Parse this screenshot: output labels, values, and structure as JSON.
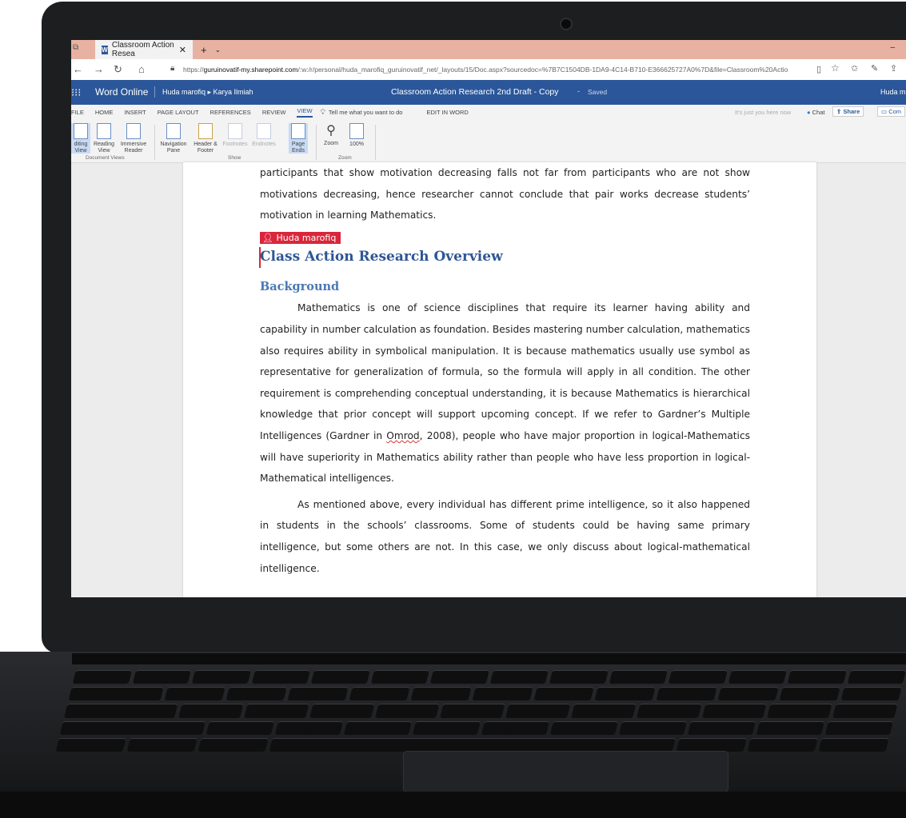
{
  "browser": {
    "tab_title": "Classroom Action Resea",
    "url_host": "guruinovatif-my.sharepoint.com",
    "url_rest": "/:w:/r/personal/huda_marofiq_guruinovatif_net/_layouts/15/Doc.aspx?sourcedoc=%7B7C1504DB-1DA9-4C14-B710-E366625727A0%7D&file=Classroom%20Actio",
    "url_scheme": "https://",
    "accent": "#e8b2a2"
  },
  "app": {
    "name": "Word Online",
    "breadcrumb": "Huda marofiq ▸ Karya Ilmiah",
    "doc_title": "Classroom Action Research 2nd Draft - Copy",
    "save_state": "Saved",
    "user": "Huda m",
    "brand_color": "#2b579a"
  },
  "ribbon_tabs": [
    "FILE",
    "HOME",
    "INSERT",
    "PAGE LAYOUT",
    "REFERENCES",
    "REVIEW",
    "VIEW"
  ],
  "ribbon_extra": {
    "tell_me": "Tell me what you want to do",
    "edit_in_word": "EDIT IN WORD",
    "presence": "It's just you here now",
    "chat": "Chat",
    "share": "Share",
    "comments": "Com"
  },
  "ribbon": {
    "editing_view": [
      "diting",
      "View"
    ],
    "reading_view": [
      "Reading",
      "View"
    ],
    "immersive_reader": [
      "Immersive",
      "Reader"
    ],
    "document_views": "Document Views",
    "navigation_pane": [
      "Navigation",
      "Pane"
    ],
    "header_footer": [
      "Header &",
      "Footer"
    ],
    "footnotes": "Footnotes",
    "endnotes": "Endnotes",
    "page_ends": [
      "Page",
      "Ends"
    ],
    "show": "Show",
    "zoom": "Zoom",
    "zoom_100": "100%",
    "zoom_group": "Zoom"
  },
  "document": {
    "para_top": "participants that show motivation decreasing falls not far from participants who are not show motivations decreasing, hence researcher cannot conclude that pair works decrease students’ motivation in learning Mathematics.",
    "author_flag": "Huda marofiq",
    "heading1": "Class Action Research Overview",
    "heading2": "Background",
    "para1_a": "Mathematics is one of science disciplines that require its learner having ability and capability in number calculation as foundation. Besides mastering number calculation, mathematics also requires ability in symbolical manipulation. It is because mathematics usually use symbol as representative for generalization of formula, so the formula will apply in all condition. The other requirement is comprehending conceptual understanding, it is because Mathematics is hierarchical knowledge that prior concept will support upcoming concept. If we refer to Gardner’s Multiple Intelligences (Gardner in ",
    "para1_word": "Omrod",
    "para1_b": ", 2008), people who have major proportion in logical-Mathematics will have superiority in Mathematics ability rather than people who have less proportion in logical-Mathematical intelligences.",
    "para2": "As mentioned above, every individual has different prime intelligence, so it also happened in students in the schools’ classrooms. Some of students could be having same primary intelligence, but some others are not. In this case, we only discuss about logical-mathematical intelligence."
  }
}
